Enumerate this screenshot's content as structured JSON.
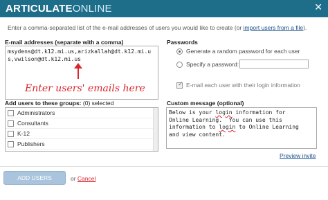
{
  "header": {
    "brand_bold": "ARTICULATE",
    "brand_light": "ONLINE",
    "close_icon": "close-icon"
  },
  "intro": {
    "text": "Enter a comma-separated list of the e-mail addresses of users you would like to create (or ",
    "link": "import users from a file",
    "suffix": ")."
  },
  "emails": {
    "label": "E-mail addresses (separate with a comma)",
    "value": "msydens@dt.k12.mi.us,arizkallah@dt.k12.mi.us,vwilson@dt.k12.mi.us",
    "annotation": "Enter users' emails here"
  },
  "groups": {
    "label_bold": "Add users to these groups:",
    "label_count": "(0) selected",
    "items": [
      "Administrators",
      "Consultants",
      "K-12",
      "Publishers"
    ]
  },
  "passwords": {
    "label": "Passwords",
    "option_random": "Generate a random password for each user",
    "option_specify": "Specify a password:",
    "random_selected": true,
    "email_each_user": "E-mail each user with their login information"
  },
  "message": {
    "label": "Custom message (optional)",
    "line1": "Below is your ",
    "w_login1": "login",
    "line1b": " information for",
    "line2": "Online Learning.  You can use this",
    "line3a": "information to ",
    "w_login2": "login",
    "line3b": " to Online Learning",
    "line4": "and view content.",
    "preview_link": "Preview invite"
  },
  "footer": {
    "add_button": "ADD USERS",
    "or": "or ",
    "cancel": "Cancel"
  },
  "colors": {
    "titlebar": "#1e6e8a",
    "annotation": "#d8262e",
    "button": "#a9c4dc"
  }
}
